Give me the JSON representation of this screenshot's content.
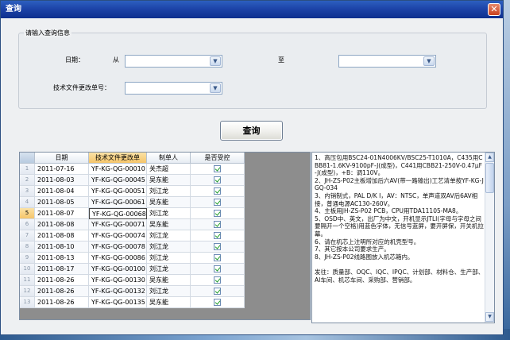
{
  "window": {
    "title": "查询"
  },
  "filter": {
    "group_title": "请输入查询信息",
    "date_label": "日期：",
    "from_label": "从",
    "to_label": "至",
    "from_value": "",
    "to_value": "",
    "doc_label": "技术文件更改单号：",
    "doc_value": ""
  },
  "query_button": "查询",
  "table": {
    "columns": [
      "日期",
      "技术文件更改单",
      "制单人",
      "是否受控"
    ],
    "rows": [
      {
        "n": "1",
        "date": "2011-07-16",
        "code": "YF-KG-QG-00010",
        "maker": "关杰超",
        "controlled": true
      },
      {
        "n": "2",
        "date": "2011-08-03",
        "code": "YF-KG-QG-00045",
        "maker": "吴东能",
        "controlled": true
      },
      {
        "n": "3",
        "date": "2011-08-04",
        "code": "YF-KG-QG-00051",
        "maker": "刘江龙",
        "controlled": true
      },
      {
        "n": "4",
        "date": "2011-08-05",
        "code": "YF-KG-QG-00061",
        "maker": "吴东能",
        "controlled": true
      },
      {
        "n": "5",
        "date": "2011-08-07",
        "code": "YF-KG-QG-00068",
        "maker": "刘江龙",
        "controlled": true
      },
      {
        "n": "6",
        "date": "2011-08-08",
        "code": "YF-KG-QG-00071",
        "maker": "吴东能",
        "controlled": true
      },
      {
        "n": "7",
        "date": "2011-08-08",
        "code": "YF-KG-QG-00074",
        "maker": "刘江龙",
        "controlled": true
      },
      {
        "n": "8",
        "date": "2011-08-10",
        "code": "YF-KG-QG-00078",
        "maker": "刘江龙",
        "controlled": true
      },
      {
        "n": "9",
        "date": "2011-08-13",
        "code": "YF-KG-QG-00086",
        "maker": "刘江龙",
        "controlled": true
      },
      {
        "n": "10",
        "date": "2011-08-17",
        "code": "YF-KG-QG-00100",
        "maker": "刘江龙",
        "controlled": true
      },
      {
        "n": "11",
        "date": "2011-08-26",
        "code": "YF-KG-QG-00130",
        "maker": "吴东能",
        "controlled": true
      },
      {
        "n": "12",
        "date": "2011-08-26",
        "code": "YF-KG-QG-00132",
        "maker": "刘江龙",
        "controlled": true
      },
      {
        "n": "13",
        "date": "2011-08-26",
        "code": "YF-KG-QG-00135",
        "maker": "吴东能",
        "controlled": true
      }
    ]
  },
  "memo": {
    "text": "1、高压包用BSC24-01N4006KV/BSC25-T1010A，C435用CBB81-1.6KV-9100pF-J(成型)，C441用CBB21-250V-0.47μF-J(成型)，+B：调110V。\n2、JH-ZS-P02主板增加后六AV(带一路输出)工艺清单按YF-KG-JGQ-034\n3、内销制式，PAL D/K I，AV：NTSC，单声道双AV后6AV相接，普通电源AC130-260V。\n4、主板用JH-ZS-P02 PCB，CPU用TDA11105-MA8。\n5、OSD中、英文，出厂为中文，开机显示JTLI(字母与字母之间要隔开一个空格)用蓝色字体，无信号蓝屏，要开屏保，开关机拉幕。\n6、请在机芯上注明所对应的机壳型号。\n7、其它按本公司要求生产。\n8、JH-ZS-P02线路图放入机芯箱内。\n\n发往：质量部、OQC、IQC、IPQC、计划部、材料仓、生产部、AI车间、机芯车间、采购部、营销部。"
  },
  "colors": {
    "title_bar": "#1d44a8",
    "header_active": "#f5c56a",
    "check": "#1e9b2a"
  }
}
